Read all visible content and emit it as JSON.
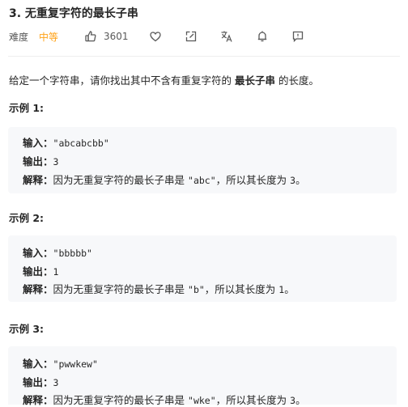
{
  "problem": {
    "title": "3. 无重复字符的最长子串",
    "difficulty_label": "难度",
    "difficulty_value": "中等",
    "likes": "3601",
    "difficulty_color": "#ffa116"
  },
  "toolbar_icons": [
    "thumbs-up-icon",
    "heart-icon",
    "share-icon",
    "translate-icon",
    "bell-icon",
    "feedback-icon"
  ],
  "description": {
    "prefix": "给定一个字符串，请你找出其中不含有重复字符的",
    "bold": "最长子串",
    "suffix": "的长度。"
  },
  "examples": [
    {
      "title": "示例 1:",
      "input_label": "输入：",
      "input": "\"abcabcbb\"",
      "output_label": "输出：",
      "output": "3",
      "explain_label": "解释：",
      "explain_pre": "因为无重复字符的最长子串是",
      "explain_code": "\"abc\"",
      "explain_mid": "，所以其长度为",
      "explain_num": "3",
      "explain_end": "。"
    },
    {
      "title": "示例 2:",
      "input_label": "输入：",
      "input": "\"bbbbb\"",
      "output_label": "输出：",
      "output": "1",
      "explain_label": "解释：",
      "explain_pre": "因为无重复字符的最长子串是",
      "explain_code": "\"b\"",
      "explain_mid": "，所以其长度为",
      "explain_num": "1",
      "explain_end": "。"
    },
    {
      "title": "示例 3:",
      "input_label": "输入：",
      "input": "\"pwwkew\"",
      "output_label": "输出：",
      "output": "3",
      "explain_label": "解释：",
      "explain_pre": "因为无重复字符的最长子串是",
      "explain_code": "\"wke\"",
      "explain_mid": "，所以其长度为",
      "explain_num": "3",
      "explain_end": "。"
    }
  ]
}
